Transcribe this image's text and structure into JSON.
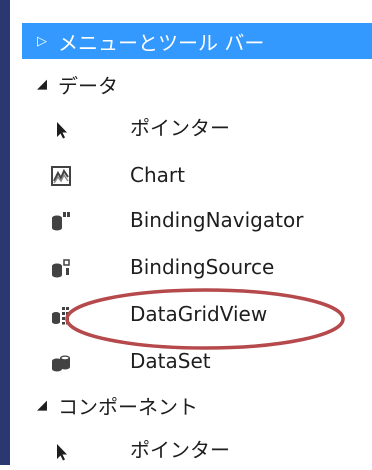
{
  "toolbox": {
    "groups": [
      {
        "label": "メニューとツール バー",
        "expanded": false,
        "selected": true,
        "arrow": "▷"
      },
      {
        "label": "データ",
        "expanded": true,
        "selected": false,
        "arrow": "◢",
        "items": [
          {
            "label": "ポインター",
            "icon": "pointer-icon"
          },
          {
            "label": "Chart",
            "icon": "chart-icon"
          },
          {
            "label": "BindingNavigator",
            "icon": "binding-navigator-icon"
          },
          {
            "label": "BindingSource",
            "icon": "binding-source-icon"
          },
          {
            "label": "DataGridView",
            "icon": "data-grid-view-icon"
          },
          {
            "label": "DataSet",
            "icon": "dataset-icon"
          }
        ]
      },
      {
        "label": "コンポーネント",
        "expanded": true,
        "selected": false,
        "arrow": "◢",
        "items": [
          {
            "label": "ポインター",
            "icon": "pointer-icon"
          }
        ]
      }
    ]
  },
  "colors": {
    "selected_background": "#3399ff",
    "left_strip": "#2b3770",
    "highlight_ellipse": "#b5494b"
  }
}
